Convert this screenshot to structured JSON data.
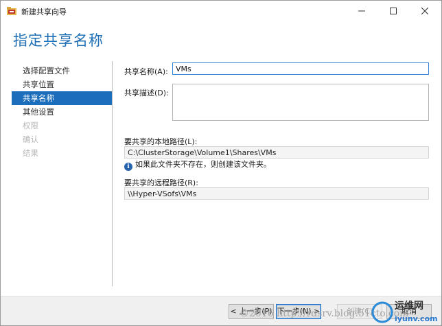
{
  "window": {
    "title": "新建共享向导"
  },
  "header": {
    "title": "指定共享名称"
  },
  "nav": {
    "items": [
      {
        "label": "选择配置文件",
        "state": "normal"
      },
      {
        "label": "共享位置",
        "state": "normal"
      },
      {
        "label": "共享名称",
        "state": "selected"
      },
      {
        "label": "其他设置",
        "state": "normal"
      },
      {
        "label": "权限",
        "state": "disabled"
      },
      {
        "label": "确认",
        "state": "disabled"
      },
      {
        "label": "结果",
        "state": "disabled"
      }
    ]
  },
  "form": {
    "share_name_label": "共享名称(A):",
    "share_name_value": "VMs",
    "share_desc_label": "共享描述(D):",
    "share_desc_value": "",
    "local_path_label": "要共享的本地路径(L):",
    "local_path_value": "C:\\ClusterStorage\\Volume1\\Shares\\VMs",
    "info_text": "如果此文件夹不存在，则创建该文件夹。",
    "remote_path_label": "要共享的远程路径(R):",
    "remote_path_value": "\\\\Hyper-VSofs\\VMs"
  },
  "footer": {
    "prev_label": "< 上一步(P)",
    "next_label": "下一步(N) >",
    "create_label": "创建(C)",
    "cancel_label": "取消"
  },
  "watermark": {
    "text": "©2016 http://rdsrv.blog.51cto.com",
    "logo_text": "运维网",
    "logo_sub": "iyunv.com"
  },
  "colors": {
    "accent": "#1e6fb5",
    "nav_selected": "#1c6dbb",
    "close_hover": "#e81123"
  }
}
